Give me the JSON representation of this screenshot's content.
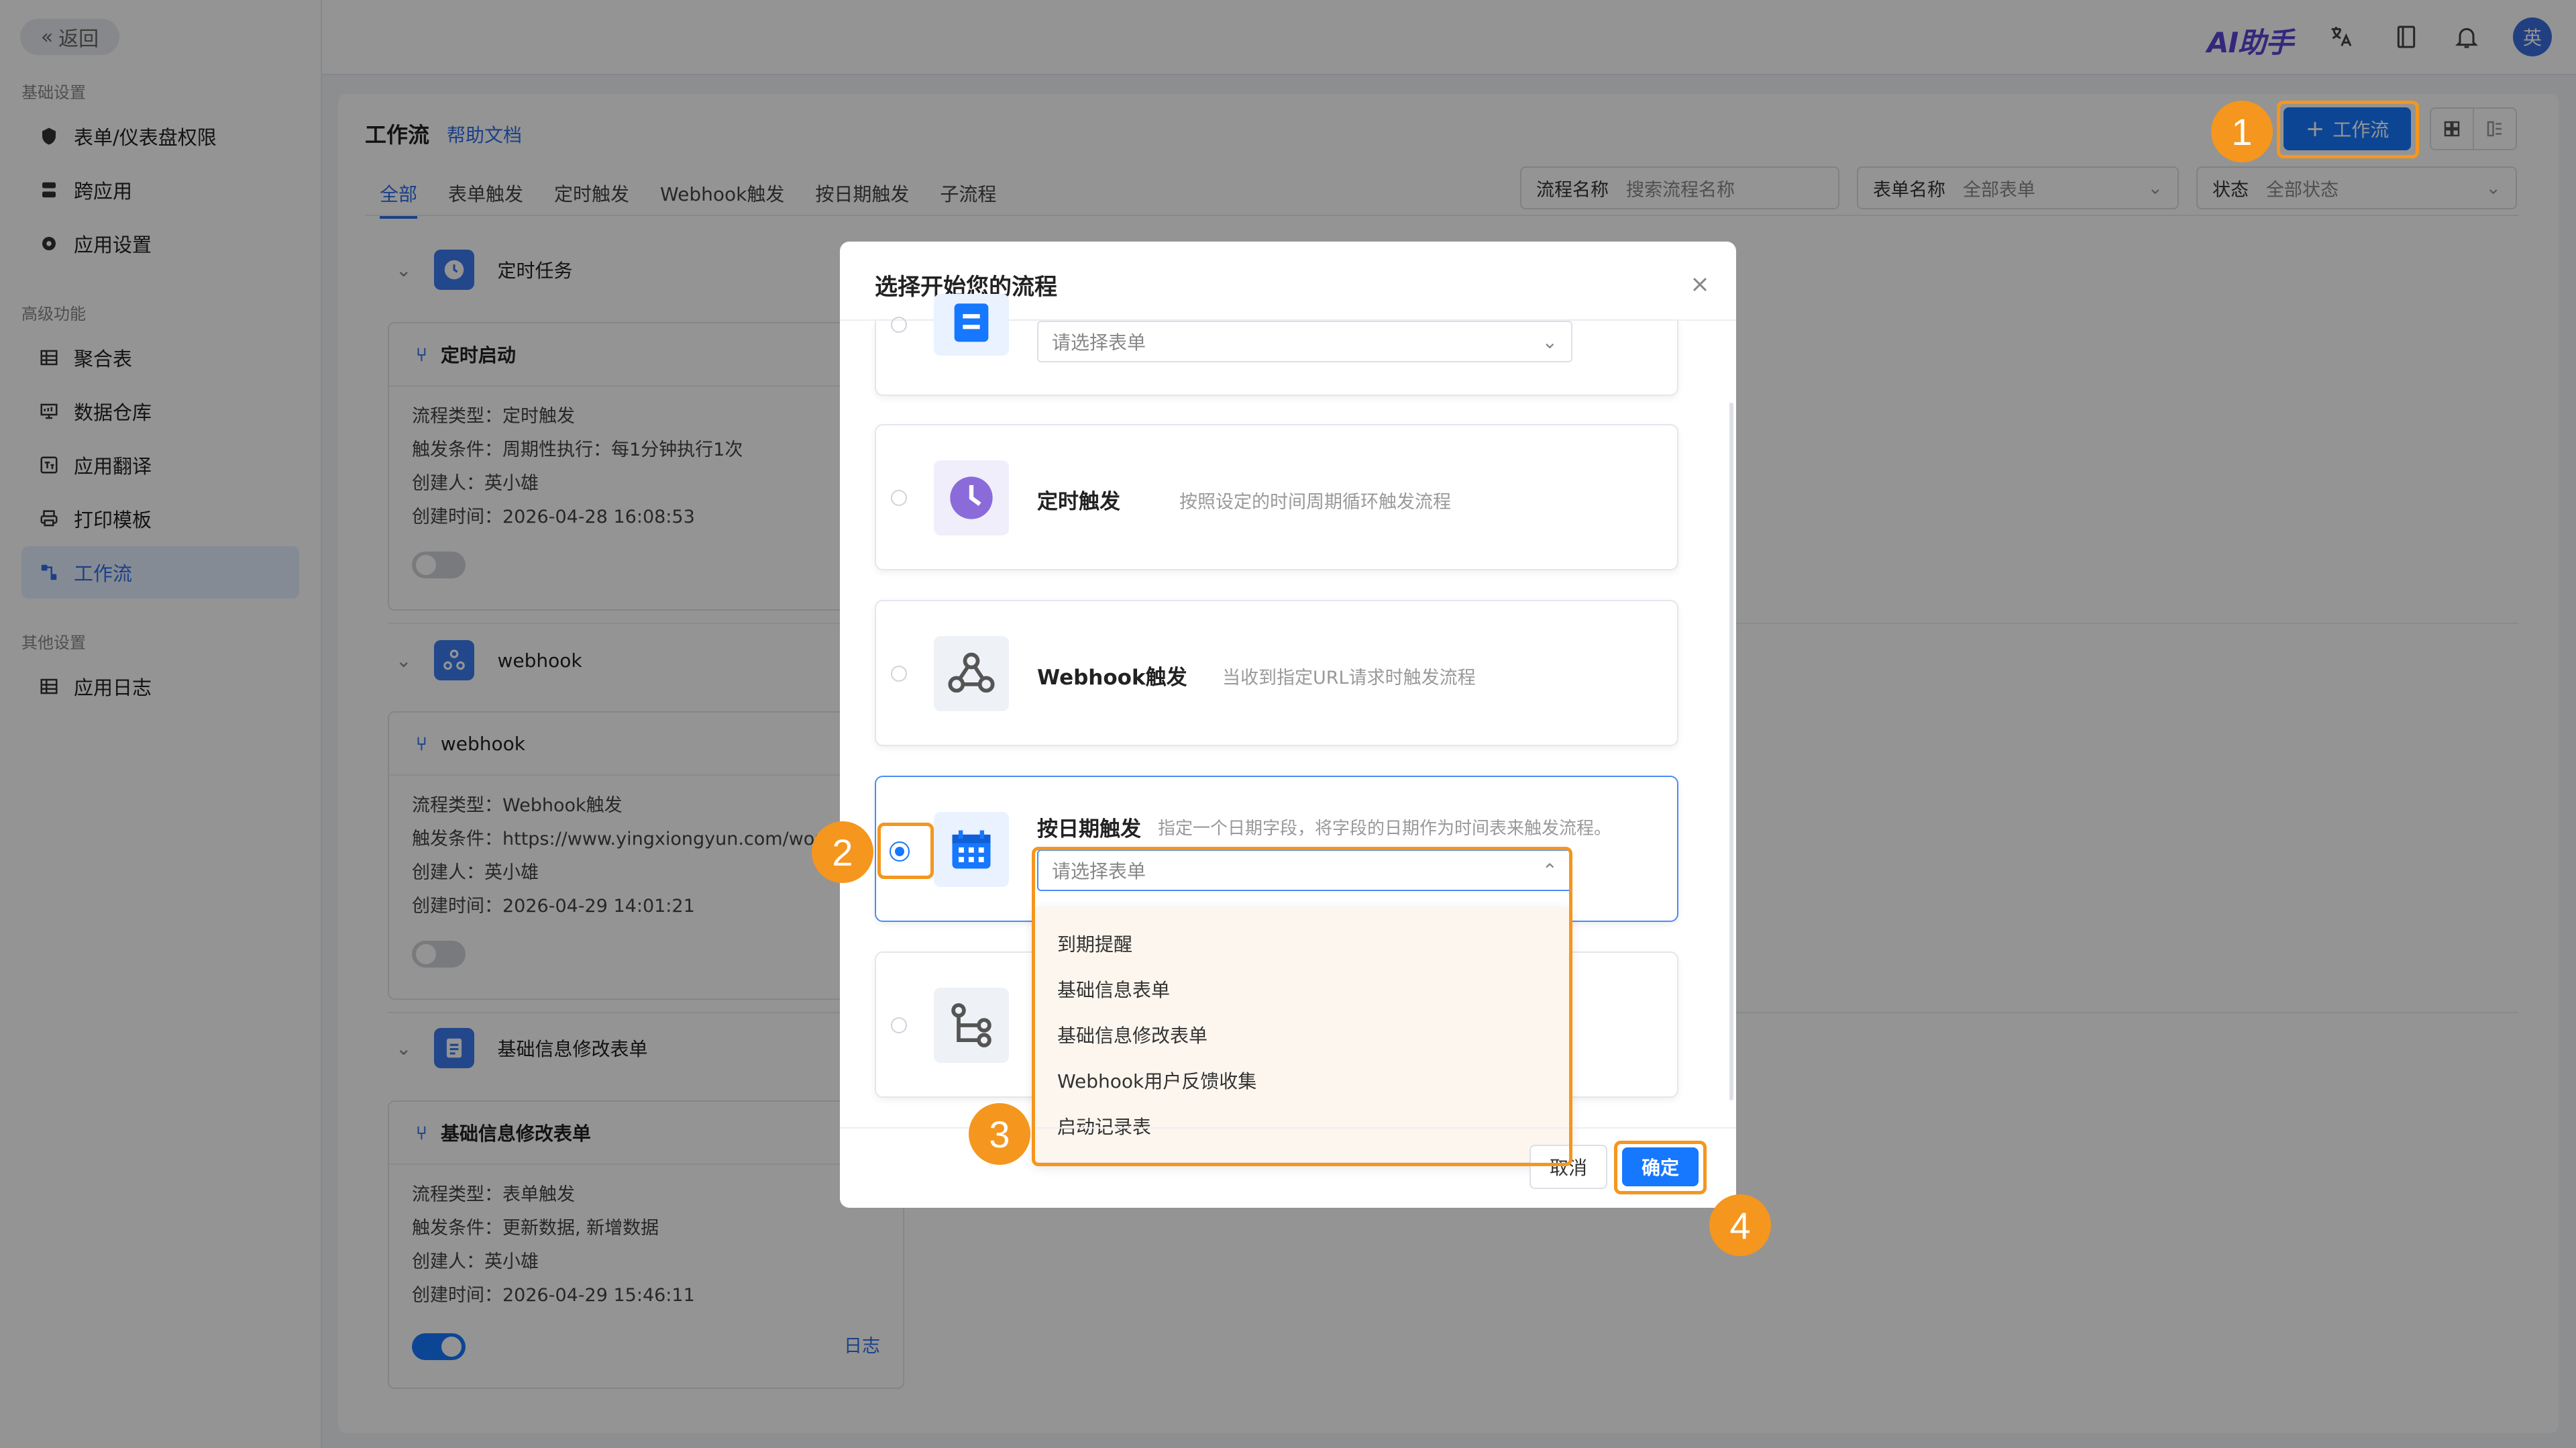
{
  "sidebar": {
    "back_label": "返回",
    "sections": [
      {
        "title": "基础设置",
        "items": [
          {
            "label": "表单/仪表盘权限",
            "icon": "shield-icon"
          },
          {
            "label": "跨应用",
            "icon": "apps-icon"
          },
          {
            "label": "应用设置",
            "icon": "gear-icon"
          }
        ]
      },
      {
        "title": "高级功能",
        "items": [
          {
            "label": "聚合表",
            "icon": "table-icon"
          },
          {
            "label": "数据仓库",
            "icon": "warehouse-icon"
          },
          {
            "label": "应用翻译",
            "icon": "translate-icon"
          },
          {
            "label": "打印模板",
            "icon": "printer-icon"
          },
          {
            "label": "工作流",
            "icon": "workflow-icon",
            "active": true
          }
        ]
      },
      {
        "title": "其他设置",
        "items": [
          {
            "label": "应用日志",
            "icon": "log-icon"
          }
        ]
      }
    ]
  },
  "header": {
    "ai_label": "AI助手",
    "avatar": "英"
  },
  "page": {
    "title": "工作流",
    "help_link": "帮助文档",
    "add_button": "工作流",
    "tabs": [
      "全部",
      "表单触发",
      "定时触发",
      "Webhook触发",
      "按日期触发",
      "子流程"
    ],
    "active_tab": "全部",
    "filters": {
      "name_label": "流程名称",
      "name_placeholder": "搜索流程名称",
      "form_label": "表单名称",
      "form_value": "全部表单",
      "status_label": "状态",
      "status_value": "全部状态"
    }
  },
  "groups": [
    {
      "title": "定时任务",
      "icon": "clock-icon",
      "card": {
        "name": "定时启动",
        "type": "流程类型：定时触发",
        "cond": "触发条件：周期性执行：每1分钟执行1次",
        "creator": "创建人：英小雄",
        "created_label": "创建时间：",
        "created": "2026-04-28 16:08:53",
        "enabled": false
      }
    },
    {
      "title": "webhook",
      "icon": "webhook-icon",
      "card": {
        "name": "webhook",
        "type": "流程类型：Webhook触发",
        "cond": "触发条件：https://www.yingxiongyun.com/workf",
        "creator": "创建人：英小雄",
        "created_label": "创建时间：",
        "created": "2026-04-29 14:01:21",
        "enabled": false
      }
    },
    {
      "title": "基础信息修改表单",
      "icon": "form-icon",
      "card": {
        "name": "基础信息修改表单",
        "type": "流程类型：表单触发",
        "cond": "触发条件：更新数据, 新增数据",
        "creator": "创建人：英小雄",
        "created_label": "创建时间：",
        "created": "2026-04-29 15:46:11",
        "enabled": true,
        "log_link": "日志"
      }
    }
  ],
  "modal": {
    "title": "选择开始您的流程",
    "options": [
      {
        "title": "",
        "desc": "",
        "select_placeholder": "请选择表单",
        "icon": "form-icon"
      },
      {
        "title": "定时触发",
        "desc": "按照设定的时间周期循环触发流程",
        "icon": "clock-icon"
      },
      {
        "title": "Webhook触发",
        "desc": "当收到指定URL请求时触发流程",
        "icon": "webhook-icon"
      },
      {
        "title": "按日期触发",
        "desc": "指定一个日期字段，将字段的日期作为时间表来触发流程。",
        "select_placeholder": "请选择表单",
        "icon": "calendar-icon",
        "selected": true
      },
      {
        "title": "",
        "desc": "",
        "icon": "subflow-icon"
      }
    ],
    "dropdown_items": [
      "到期提醒",
      "基础信息表单",
      "基础信息修改表单",
      "Webhook用户反馈收集",
      "启动记录表"
    ],
    "cancel": "取消",
    "ok": "确定"
  },
  "markers": [
    "1",
    "2",
    "3",
    "4"
  ],
  "colors": {
    "primary": "#1677ff",
    "highlight": "#f5961e",
    "ai_brand": "#5b45d8"
  }
}
